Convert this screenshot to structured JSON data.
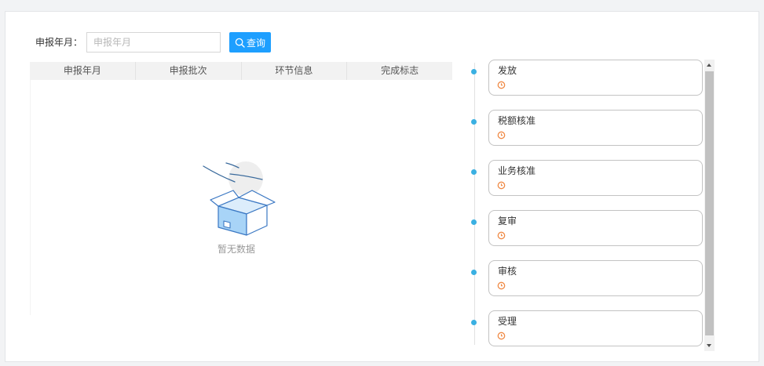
{
  "colors": {
    "accent": "#1e9fff",
    "timeline_dot": "#3ab0e2",
    "status_icon": "#f08a45"
  },
  "search": {
    "label": "申报年月：",
    "placeholder": "申报年月",
    "value": "",
    "button_label": "查询",
    "button_icon": "search-icon"
  },
  "table": {
    "columns": [
      "申报年月",
      "申报批次",
      "环节信息",
      "完成标志"
    ],
    "rows": [],
    "empty_text": "暂无数据",
    "empty_icon": "empty-box-icon"
  },
  "timeline": {
    "items": [
      {
        "title": "发放",
        "status_icon": "clock-icon"
      },
      {
        "title": "税额核准",
        "status_icon": "clock-icon"
      },
      {
        "title": "业务核准",
        "status_icon": "clock-icon"
      },
      {
        "title": "复审",
        "status_icon": "clock-icon"
      },
      {
        "title": "审核",
        "status_icon": "clock-icon"
      },
      {
        "title": "受理",
        "status_icon": "clock-icon"
      }
    ]
  }
}
